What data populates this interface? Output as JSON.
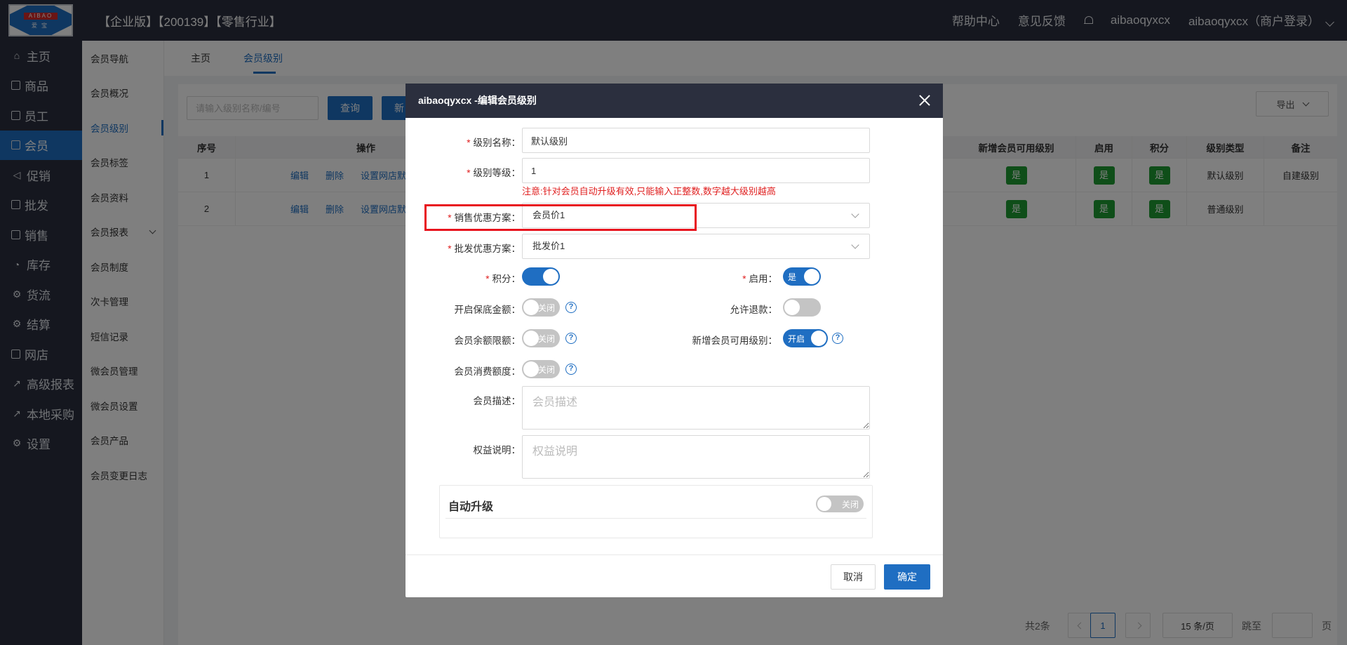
{
  "header": {
    "logo_text": "AIBAO",
    "logo_sub": "爱宝",
    "title": "【企业版】【200139】【零售行业】",
    "help_center": "帮助中心",
    "feedback": "意见反馈",
    "username": "aibaoqyxcx",
    "account": "aibaoqyxcx（商户登录）"
  },
  "mainnav": [
    {
      "label": "主页",
      "icon": "home-icon"
    },
    {
      "label": "商品",
      "icon": "goods-icon"
    },
    {
      "label": "员工",
      "icon": "staff-icon"
    },
    {
      "label": "会员",
      "icon": "member-icon"
    },
    {
      "label": "促销",
      "icon": "promo-icon"
    },
    {
      "label": "批发",
      "icon": "wholesale-icon"
    },
    {
      "label": "销售",
      "icon": "sales-icon"
    },
    {
      "label": "库存",
      "icon": "stock-icon"
    },
    {
      "label": "货流",
      "icon": "logistics-icon"
    },
    {
      "label": "结算",
      "icon": "settle-icon"
    },
    {
      "label": "网店",
      "icon": "shop-icon"
    },
    {
      "label": "高级报表",
      "icon": "report-icon"
    },
    {
      "label": "本地采购",
      "icon": "purchase-icon"
    },
    {
      "label": "设置",
      "icon": "settings-icon"
    }
  ],
  "subnav": [
    "会员导航",
    "会员概况",
    "会员级别",
    "会员标签",
    "会员资料",
    "会员报表",
    "会员制度",
    "次卡管理",
    "短信记录",
    "微会员管理",
    "微会员设置",
    "会员产品",
    "会员变更日志"
  ],
  "tabs": {
    "home": "主页",
    "member_level": "会员级别"
  },
  "toolbar": {
    "search_placeholder": "请输入级别名称/编号",
    "query": "查询",
    "add": "新",
    "export": "导出"
  },
  "table": {
    "headers": {
      "index": "序号",
      "ops": "操作",
      "new_member": "新增会员可用级别",
      "enabled": "启用",
      "points": "积分",
      "level_type": "级别类型",
      "remark": "备注"
    },
    "rows": [
      {
        "index": "1",
        "edit": "编辑",
        "delete": "删除",
        "set_default": "设置网店默",
        "new_member": "是",
        "enabled": "是",
        "points": "是",
        "level_type": "默认级别",
        "remark": "自建级别"
      },
      {
        "index": "2",
        "edit": "编辑",
        "delete": "删除",
        "set_default": "设置网店默",
        "new_member": "是",
        "enabled": "是",
        "points": "是",
        "level_type": "普通级别",
        "remark": ""
      }
    ]
  },
  "pager": {
    "total": "共2条",
    "page": "1",
    "page_size": "15 条/页",
    "jump": "跳至",
    "page_unit": "页"
  },
  "modal": {
    "title": "aibaoqyxcx -编辑会员级别",
    "level_name_label": "级别名称：",
    "level_name_value": "默认级别",
    "level_rank_label": "级别等级：",
    "level_rank_value": "1",
    "note": "注意:针对会员自动升级有效,只能输入正整数,数字越大级别越高",
    "sale_plan_label": "销售优惠方案：",
    "sale_plan_value": "会员价1",
    "wholesale_plan_label": "批发优惠方案：",
    "wholesale_plan_value": "批发价1",
    "points_label": "积分：",
    "enabled_label": "启用：",
    "enabled_on": "是",
    "deposit_label": "开启保底金额：",
    "off_text": "关闭",
    "refund_label": "允许退款：",
    "balance_limit_label": "会员余额限额：",
    "new_member_label": "新增会员可用级别：",
    "new_member_on": "开启",
    "consume_limit_label": "会员消费额度：",
    "desc_label": "会员描述：",
    "desc_placeholder": "会员描述",
    "rights_label": "权益说明：",
    "rights_placeholder": "权益说明",
    "auto_upgrade": "自动升级",
    "auto_upgrade_off": "关闭",
    "cancel": "取消",
    "confirm": "确定"
  },
  "colors": {
    "primary": "#1f6ec2",
    "success": "#1e9d32",
    "danger": "#e02020",
    "dark": "#2b2f3e"
  }
}
